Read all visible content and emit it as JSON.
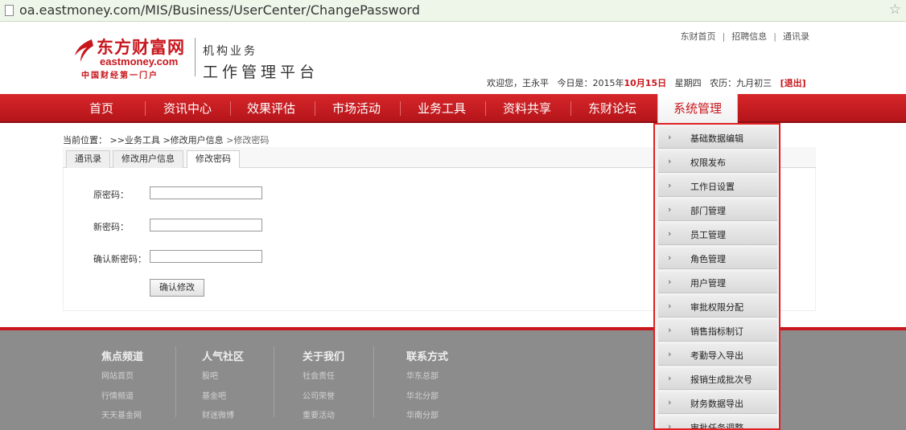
{
  "browser": {
    "url": "oa.eastmoney.com/MIS/Business/UserCenter/ChangePassword"
  },
  "header": {
    "logo_name": "东方财富网",
    "logo_en": "eastmoney.com",
    "logo_slogan": "中国财经第一门户",
    "platform_sub": "机构业务",
    "platform_title": "工作管理平台",
    "top_links": [
      "东财首页",
      "招聘信息",
      "通讯录"
    ],
    "welcome": {
      "greeting": "欢迎您，",
      "user": "王永平",
      "today_label": "今日是：",
      "year": "2015年",
      "date": "10月15日",
      "weekday": "星期四",
      "lunar": "农历：九月初三",
      "logout": "[退出]"
    }
  },
  "nav": {
    "items": [
      "首页",
      "资讯中心",
      "效果评估",
      "市场活动",
      "业务工具",
      "资料共享",
      "东财论坛",
      "系统管理"
    ],
    "active_index": 7
  },
  "breadcrumb": {
    "label": "当前位置：",
    "items": [
      ">>业务工具",
      ">修改用户信息",
      ">修改密码"
    ]
  },
  "tabs": [
    "通讯录",
    "修改用户信息",
    "修改密码"
  ],
  "form": {
    "old_password_label": "原密码：",
    "new_password_label": "新密码：",
    "confirm_password_label": "确认新密码：",
    "submit_label": "确认修改"
  },
  "footer": {
    "columns": [
      {
        "title": "焦点频道",
        "links": [
          "网站首页",
          "行情频道",
          "天天基金网"
        ]
      },
      {
        "title": "人气社区",
        "links": [
          "股吧",
          "基金吧",
          "财迷微博"
        ]
      },
      {
        "title": "关于我们",
        "links": [
          "社会责任",
          "公司荣誉",
          "重要活动"
        ]
      },
      {
        "title": "联系方式",
        "links": [
          "华东总部",
          "华北分部",
          "华南分部"
        ]
      }
    ]
  },
  "dropdown": {
    "items": [
      "基础数据编辑",
      "权限发布",
      "工作日设置",
      "部门管理",
      "员工管理",
      "角色管理",
      "用户管理",
      "审批权限分配",
      "销售指标制订",
      "考勤导入导出",
      "报销生成批次号",
      "财务数据导出",
      "审批任务调整"
    ]
  },
  "colors": {
    "brand_red": "#c8161d",
    "highlight_border": "#e02024",
    "footer_gray": "#8c8c8c"
  }
}
